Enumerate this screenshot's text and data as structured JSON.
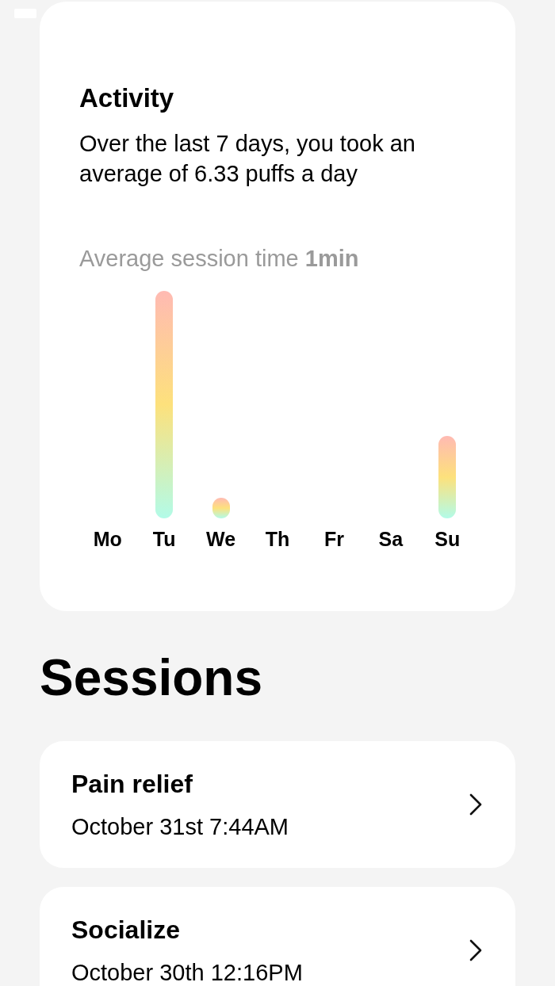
{
  "activity": {
    "title": "Activity",
    "summary": "Over the last 7 days, you took an average of 6.33 puffs a day",
    "session_time": "Average session time **1min**",
    "days": [
      {
        "label": "Mo"
      },
      {
        "label": "Tu"
      },
      {
        "label": "We"
      },
      {
        "label": "Th"
      },
      {
        "label": "Fr"
      },
      {
        "label": "Sa"
      },
      {
        "label": "Su"
      }
    ]
  },
  "sessions": {
    "title": "Sessions",
    "items": [
      {
        "name": "Pain relief",
        "time": "October 31st 7:44AM"
      },
      {
        "name": "Socialize",
        "time": "October 30th 12:16PM"
      }
    ]
  }
}
